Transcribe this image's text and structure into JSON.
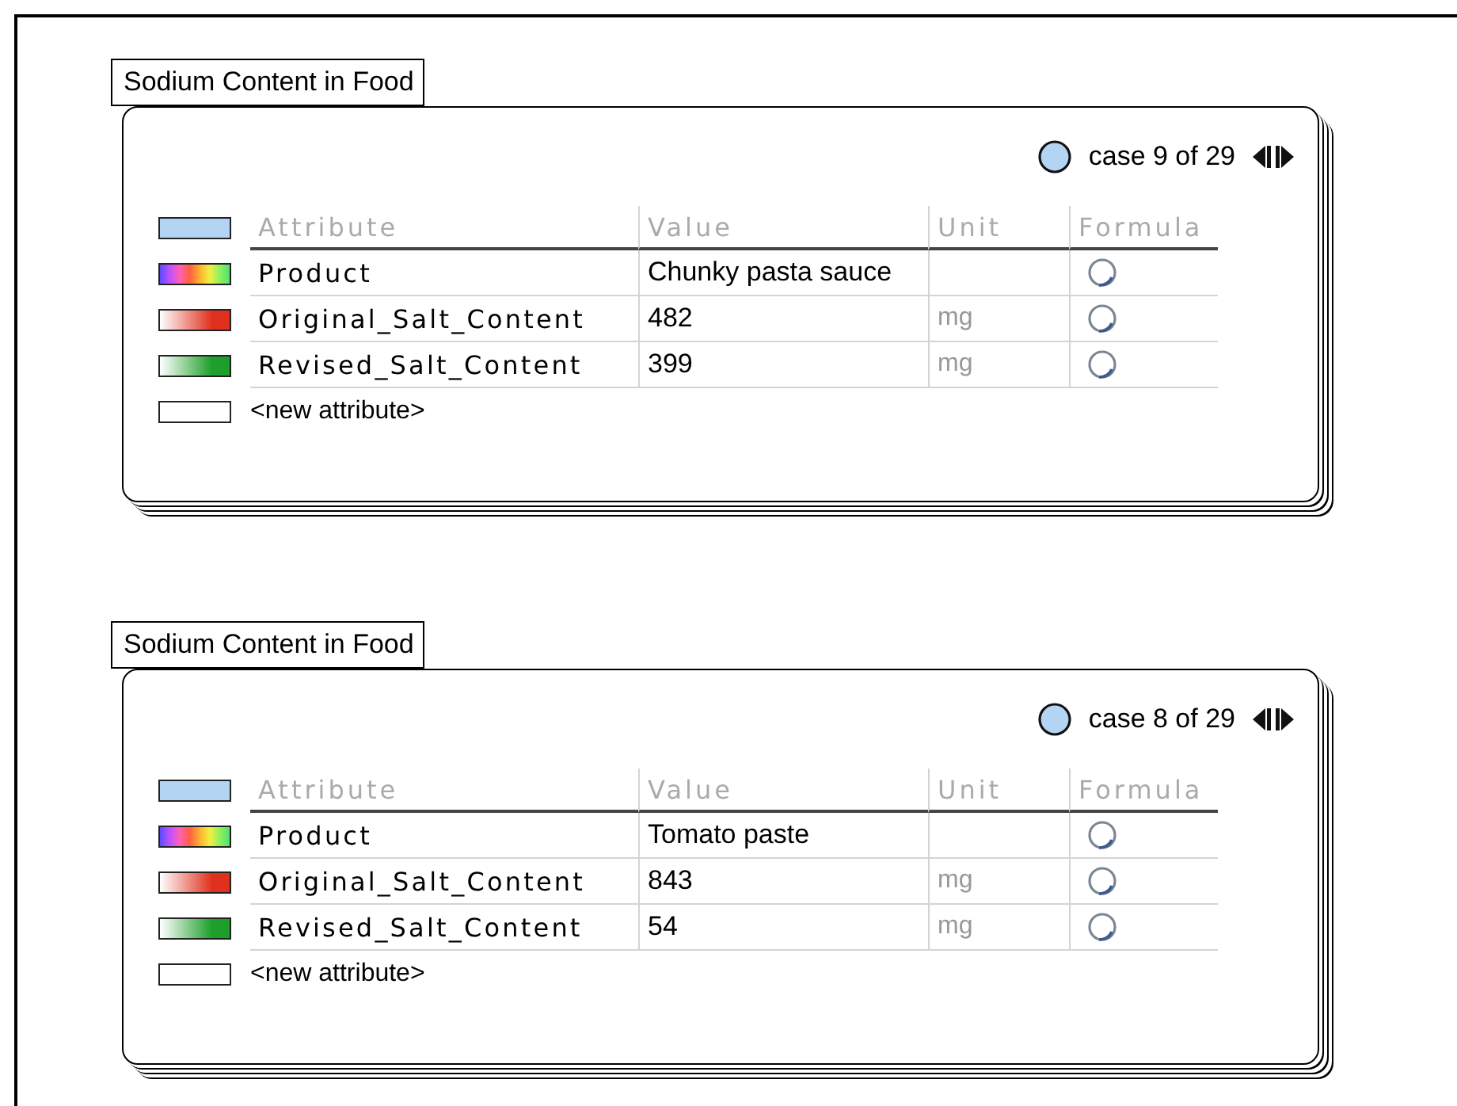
{
  "cards": [
    {
      "title": "Sodium Content in Food",
      "case_text": "case 9 of 29",
      "columns": [
        "Attribute",
        "Value",
        "Unit",
        "Formula"
      ],
      "attributes": [
        {
          "name": "Product",
          "kind": "categorical",
          "value": "Chunky pasta sauce"
        },
        {
          "name": "Original_Salt_Content",
          "kind": "numeric",
          "color": "#e0301e",
          "value": "482",
          "unit": "mg"
        },
        {
          "name": "Revised_Salt_Content",
          "kind": "numeric",
          "color": "#1e9e2a",
          "value": "399",
          "unit": "mg"
        }
      ],
      "new_attribute": "<new attribute>"
    },
    {
      "title": "Sodium Content in Food",
      "case_text": "case 8 of 29",
      "columns": [
        "Attribute",
        "Value",
        "Unit",
        "Formula"
      ],
      "attributes": [
        {
          "name": "Product",
          "kind": "categorical",
          "value": "Tomato paste"
        },
        {
          "name": "Original_Salt_Content",
          "kind": "numeric",
          "color": "#e0301e",
          "value": "843",
          "unit": "mg"
        },
        {
          "name": "Revised_Salt_Content",
          "kind": "numeric",
          "color": "#1e9e2a",
          "value": "54",
          "unit": "mg"
        }
      ],
      "new_attribute": "<new attribute>"
    }
  ]
}
